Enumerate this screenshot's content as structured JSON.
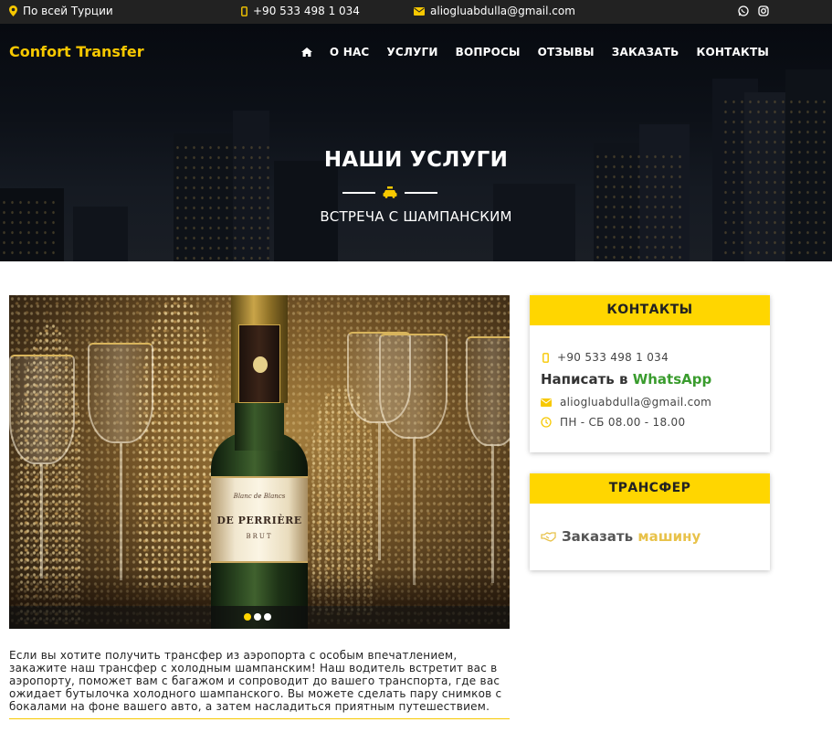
{
  "topbar": {
    "location": "По всей Турции",
    "phone": "+90 533 498 1 034",
    "email": "aliogluabdulla@gmail.com",
    "icons": [
      "map-pin-icon",
      "mobile-icon",
      "envelope-icon",
      "whatsapp-icon",
      "instagram-icon"
    ]
  },
  "header": {
    "logo": "Confort Transfer",
    "nav": [
      "О НАС",
      "УСЛУГИ",
      "ВОПРОСЫ",
      "ОТЗЫВЫ",
      "ЗАКАЗАТЬ",
      "КОНТАКТЫ"
    ],
    "title": "НАШИ УСЛУГИ",
    "subtitle": "ВСТРЕЧА С ШАМПАНСКИМ"
  },
  "slider": {
    "label_line1": "Blanc de Blancs",
    "label_brand": "DE PERRIÈRE",
    "label_line3": "BRUT",
    "dots": 3,
    "active_dot": 0
  },
  "description": "Если вы хотите получить трансфер из аэропорта с особым впечатлением, закажите наш трансфер с холодным шампанским! Наш водитель встретит вас в аэропорту, поможет вам с багажом и сопроводит до вашего транспорта, где вас ожидает бутылочка холодного шампанского. Вы можете сделать пару снимков с бокалами на фоне вашего авто, а затем насладиться приятным путешествием.",
  "contacts": {
    "title": "КОНТАКТЫ",
    "phone": "+90 533 498 1 034",
    "whatsapp_prefix": "Написать в ",
    "whatsapp_word": "WhatsApp",
    "email": "aliogluabdulla@gmail.com",
    "hours": "ПН - СБ 08.00 - 18.00"
  },
  "transfer": {
    "title": "ТРАНСФЕР",
    "order_prefix": "Заказать ",
    "order_word": "машину"
  },
  "colors": {
    "accent": "#ffd600",
    "whatsapp": "#3a9c2e",
    "topbar": "#222222"
  }
}
